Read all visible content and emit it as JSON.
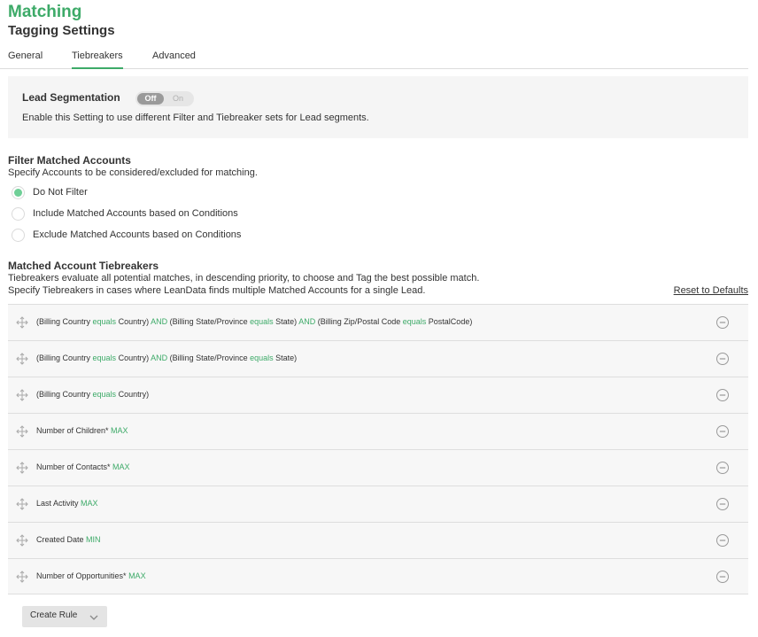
{
  "header": {
    "app_title": "Matching",
    "page_title": "Tagging Settings"
  },
  "tabs": [
    {
      "label": "General",
      "active": false
    },
    {
      "label": "Tiebreakers",
      "active": true
    },
    {
      "label": "Advanced",
      "active": false
    }
  ],
  "lead_segmentation": {
    "title": "Lead Segmentation",
    "toggle_off": "Off",
    "toggle_on": "On",
    "state": "Off",
    "description": "Enable this Setting to use different Filter and Tiebreaker sets for Lead segments."
  },
  "filter": {
    "title": "Filter Matched Accounts",
    "description": "Specify Accounts to be considered/excluded for matching.",
    "options": [
      {
        "label": "Do Not Filter",
        "checked": true
      },
      {
        "label": "Include Matched Accounts based on Conditions",
        "checked": false
      },
      {
        "label": "Exclude Matched Accounts based on Conditions",
        "checked": false
      }
    ]
  },
  "tiebreakers": {
    "title": "Matched Account Tiebreakers",
    "description_1": "Tiebreakers evaluate all potential matches, in descending priority, to choose and Tag the best possible match.",
    "description_2": "Specify Tiebreakers in cases where LeanData finds multiple Matched Accounts for a single Lead.",
    "reset_label": "Reset to Defaults",
    "rules": [
      [
        {
          "t": "(Billing Country ",
          "k": false
        },
        {
          "t": "equals",
          "k": true
        },
        {
          "t": " Country) ",
          "k": false
        },
        {
          "t": "AND",
          "k": true
        },
        {
          "t": " (Billing State/Province ",
          "k": false
        },
        {
          "t": "equals",
          "k": true
        },
        {
          "t": " State) ",
          "k": false
        },
        {
          "t": "AND",
          "k": true
        },
        {
          "t": " (Billing Zip/Postal Code ",
          "k": false
        },
        {
          "t": "equals",
          "k": true
        },
        {
          "t": " PostalCode)",
          "k": false
        }
      ],
      [
        {
          "t": "(Billing Country ",
          "k": false
        },
        {
          "t": "equals",
          "k": true
        },
        {
          "t": " Country) ",
          "k": false
        },
        {
          "t": "AND",
          "k": true
        },
        {
          "t": " (Billing State/Province ",
          "k": false
        },
        {
          "t": "equals",
          "k": true
        },
        {
          "t": " State)",
          "k": false
        }
      ],
      [
        {
          "t": "(Billing Country ",
          "k": false
        },
        {
          "t": "equals",
          "k": true
        },
        {
          "t": " Country)",
          "k": false
        }
      ],
      [
        {
          "t": "Number of Children* ",
          "k": false
        },
        {
          "t": "MAX",
          "k": true
        }
      ],
      [
        {
          "t": "Number of Contacts* ",
          "k": false
        },
        {
          "t": "MAX",
          "k": true
        }
      ],
      [
        {
          "t": "Last Activity ",
          "k": false
        },
        {
          "t": "MAX",
          "k": true
        }
      ],
      [
        {
          "t": "Created Date ",
          "k": false
        },
        {
          "t": "MIN",
          "k": true
        }
      ],
      [
        {
          "t": "Number of Opportunities* ",
          "k": false
        },
        {
          "t": "MAX",
          "k": true
        }
      ]
    ]
  },
  "create_rule": {
    "label": "Create Rule"
  },
  "colors": {
    "accent": "#3daa68",
    "radio_checked": "#6fcf97",
    "panel_bg": "#f5f5f5"
  },
  "icons": {
    "drag": "drag-move-icon",
    "remove": "minus-circle-icon",
    "dropdown": "chevron-down-icon"
  }
}
